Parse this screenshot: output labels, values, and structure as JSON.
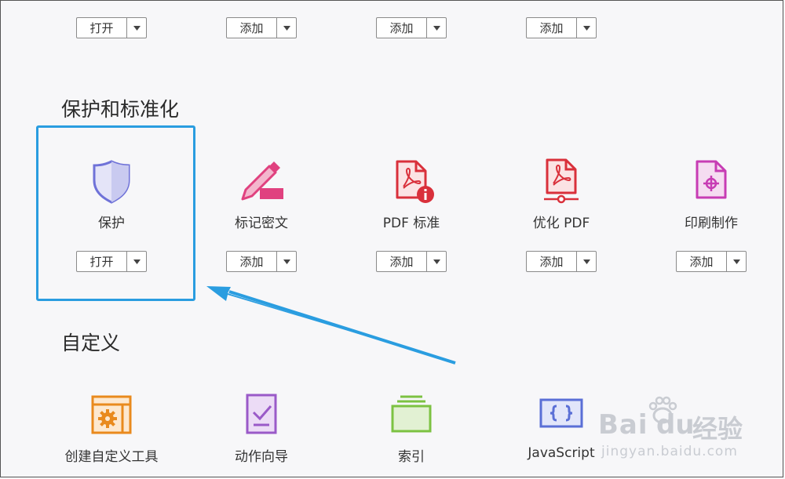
{
  "top_row": {
    "buttons": [
      {
        "label": "打开"
      },
      {
        "label": "添加"
      },
      {
        "label": "添加"
      },
      {
        "label": "添加"
      }
    ]
  },
  "protect_section": {
    "title": "保护和标准化",
    "tools": [
      {
        "name": "保护",
        "button": "打开",
        "icon": "shield-icon",
        "color": "#6f72d8"
      },
      {
        "name": "标记密文",
        "button": "添加",
        "icon": "redact-marker-icon",
        "color": "#e0417f"
      },
      {
        "name": "PDF 标准",
        "button": "添加",
        "icon": "pdf-standard-icon",
        "color": "#d9303b"
      },
      {
        "name": "优化 PDF",
        "button": "添加",
        "icon": "optimize-pdf-icon",
        "color": "#d9303b"
      },
      {
        "name": "印刷制作",
        "button": "添加",
        "icon": "print-production-icon",
        "color": "#c73cb4"
      }
    ]
  },
  "custom_section": {
    "title": "自定义",
    "tools": [
      {
        "name": "创建自定义工具",
        "icon": "custom-tool-gear-icon",
        "color": "#e98a1d"
      },
      {
        "name": "动作向导",
        "icon": "action-wizard-icon",
        "color": "#9a5ac8"
      },
      {
        "name": "索引",
        "icon": "index-icon",
        "color": "#7cc242"
      },
      {
        "name": "JavaScript",
        "icon": "javascript-braces-icon",
        "color": "#5a6fd6"
      }
    ]
  },
  "watermark": {
    "brand_left": "Bai",
    "brand_right": "du",
    "brand_cn": "经验",
    "url": "jingyan.baidu.com"
  },
  "colors": {
    "highlight": "#2a9de0",
    "arrow": "#2a9de0"
  }
}
